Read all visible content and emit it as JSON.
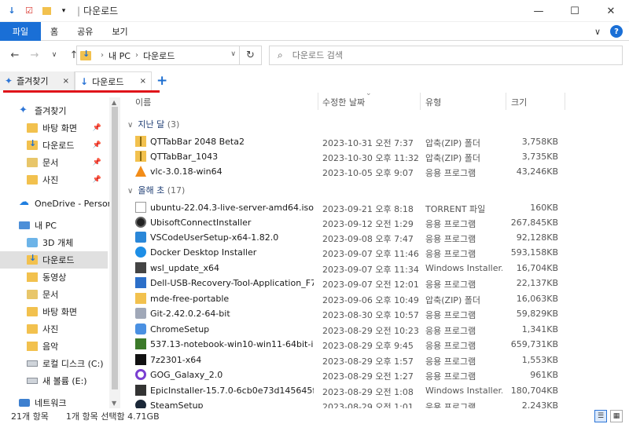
{
  "window": {
    "title": "다운로드",
    "quick_access_icons": [
      "arrow-down-icon",
      "checklist-icon",
      "folder-icon",
      "dropdown-icon"
    ],
    "controls": {
      "minimize": "—",
      "maximize": "☐",
      "close": "✕"
    }
  },
  "ribbon": {
    "file_tab": "파일",
    "tabs": [
      "홈",
      "공유",
      "보기"
    ],
    "collapse": "∨",
    "help": "?"
  },
  "navigation": {
    "back": "←",
    "forward": "→",
    "recent": "∨",
    "up": "↑",
    "address_crumbs": [
      "내 PC",
      "다운로드"
    ],
    "refresh": "↻",
    "search_placeholder": "다운로드 검색"
  },
  "qttabs": {
    "tabs": [
      {
        "label": "즐겨찾기",
        "close": "×",
        "icon": "pin-icon"
      },
      {
        "label": "다운로드",
        "close": "×",
        "icon": "download-icon"
      }
    ],
    "add": "+"
  },
  "sidebar": {
    "items": [
      {
        "label": "즐겨찾기",
        "icon": "star-icon"
      },
      {
        "label": "바탕 화면",
        "icon": "folder-icon",
        "pinned": true
      },
      {
        "label": "다운로드",
        "icon": "download-folder-icon",
        "pinned": true
      },
      {
        "label": "문서",
        "icon": "documents-icon",
        "pinned": true
      },
      {
        "label": "사진",
        "icon": "pictures-icon",
        "pinned": true
      },
      {
        "label": "OneDrive - Persona",
        "icon": "cloud-icon"
      },
      {
        "label": "내 PC",
        "icon": "pc-icon"
      },
      {
        "label": "3D 개체",
        "icon": "3d-objects-icon"
      },
      {
        "label": "다운로드",
        "icon": "download-folder-icon",
        "selected": true
      },
      {
        "label": "동영상",
        "icon": "videos-icon"
      },
      {
        "label": "문서",
        "icon": "documents-icon"
      },
      {
        "label": "바탕 화면",
        "icon": "folder-icon"
      },
      {
        "label": "사진",
        "icon": "pictures-icon"
      },
      {
        "label": "음악",
        "icon": "music-icon"
      },
      {
        "label": "로컬 디스크 (C:)",
        "icon": "drive-icon"
      },
      {
        "label": "새 볼륨 (E:)",
        "icon": "drive-icon"
      },
      {
        "label": "네트워크",
        "icon": "network-icon"
      }
    ]
  },
  "columns": {
    "name": "이름",
    "date": "수정한 날짜",
    "type": "유형",
    "size": "크기"
  },
  "groups": [
    {
      "title": "지난 달",
      "count": "(3)"
    },
    {
      "title": "올해 초",
      "count": "(17)"
    }
  ],
  "files": [
    {
      "name": "QTTabBar 2048 Beta2",
      "date": "2023-10-31 오전 7:37",
      "type": "압축(ZIP) 폴더",
      "size": "3,758KB",
      "icon": "zip-folder-icon"
    },
    {
      "name": "QTTabBar_1043",
      "date": "2023-10-30 오후 11:32",
      "type": "압축(ZIP) 폴더",
      "size": "3,735KB",
      "icon": "zip-folder-icon"
    },
    {
      "name": "vlc-3.0.18-win64",
      "date": "2023-10-05 오후 9:07",
      "type": "응용 프로그램",
      "size": "43,246KB",
      "icon": "vlc-icon"
    },
    {
      "name": "ubuntu-22.04.3-live-server-amd64.iso.to...",
      "date": "2023-09-21 오후 8:18",
      "type": "TORRENT 파일",
      "size": "160KB",
      "icon": "file-icon"
    },
    {
      "name": "UbisoftConnectInstaller",
      "date": "2023-09-12 오전 1:29",
      "type": "응용 프로그램",
      "size": "267,845KB",
      "icon": "ubisoft-icon"
    },
    {
      "name": "VSCodeUserSetup-x64-1.82.0",
      "date": "2023-09-08 오후 7:47",
      "type": "응용 프로그램",
      "size": "92,128KB",
      "icon": "vscode-icon"
    },
    {
      "name": "Docker Desktop Installer",
      "date": "2023-09-07 오후 11:46",
      "type": "응용 프로그램",
      "size": "593,158KB",
      "icon": "docker-icon"
    },
    {
      "name": "wsl_update_x64",
      "date": "2023-09-07 오후 11:34",
      "type": "Windows Installer...",
      "size": "16,704KB",
      "icon": "installer-icon"
    },
    {
      "name": "Dell-USB-Recovery-Tool-Application_F7...",
      "date": "2023-09-07 오전 12:01",
      "type": "응용 프로그램",
      "size": "22,137KB",
      "icon": "dell-icon"
    },
    {
      "name": "mde-free-portable",
      "date": "2023-09-06 오후 10:49",
      "type": "압축(ZIP) 폴더",
      "size": "16,063KB",
      "icon": "zip-folder-icon"
    },
    {
      "name": "Git-2.42.0.2-64-bit",
      "date": "2023-08-30 오후 10:57",
      "type": "응용 프로그램",
      "size": "59,829KB",
      "icon": "git-icon"
    },
    {
      "name": "ChromeSetup",
      "date": "2023-08-29 오전 10:23",
      "type": "응용 프로그램",
      "size": "1,341KB",
      "icon": "chrome-setup-icon"
    },
    {
      "name": "537.13-notebook-win10-win11-64bit-int...",
      "date": "2023-08-29 오후 9:45",
      "type": "응용 프로그램",
      "size": "659,731KB",
      "icon": "nvidia-icon"
    },
    {
      "name": "7z2301-x64",
      "date": "2023-08-29 오후 1:57",
      "type": "응용 프로그램",
      "size": "1,553KB",
      "icon": "7zip-icon"
    },
    {
      "name": "GOG_Galaxy_2.0",
      "date": "2023-08-29 오전 1:27",
      "type": "응용 프로그램",
      "size": "961KB",
      "icon": "gog-icon"
    },
    {
      "name": "EpicInstaller-15.7.0-6cb0e73d145645f98...",
      "date": "2023-08-29 오전 1:08",
      "type": "Windows Installer...",
      "size": "180,704KB",
      "icon": "epic-icon"
    },
    {
      "name": "SteamSetup",
      "date": "2023-08-29 오전 1:01",
      "type": "응용 프로그램",
      "size": "2,243KB",
      "icon": "steam-icon"
    }
  ],
  "status": {
    "item_count": "21개 항목",
    "selection": "1개 항목 선택함 4.71GB"
  },
  "view_buttons": {
    "details": "☰",
    "large_icons": "▦"
  }
}
